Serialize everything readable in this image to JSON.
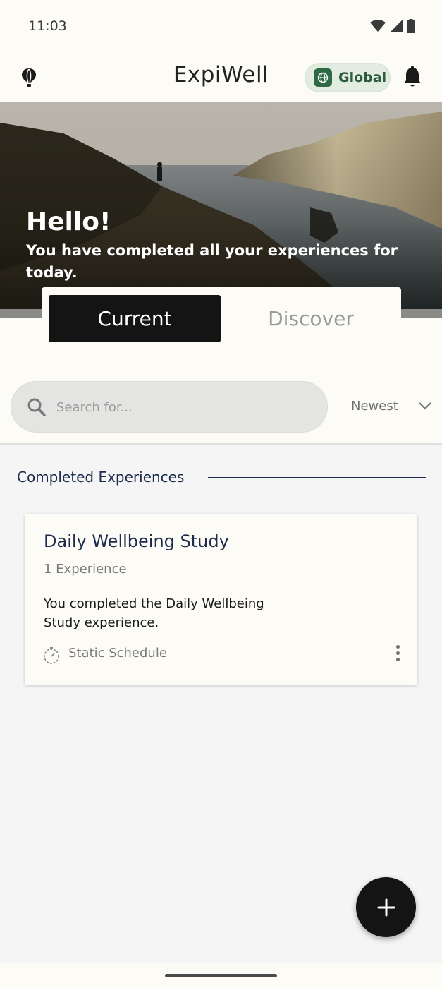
{
  "status_bar": {
    "time": "11:03",
    "icons": [
      "wifi-icon",
      "signal-icon",
      "battery-icon"
    ]
  },
  "header": {
    "title": "ExpiWell",
    "scope_chip": "Global",
    "icons": [
      "balloon-icon",
      "globe-icon",
      "bell-icon"
    ]
  },
  "hero": {
    "greeting": "Hello!",
    "message": "You have completed all your experiences for today."
  },
  "tabs": [
    {
      "label": "Current",
      "selected": true
    },
    {
      "label": "Discover",
      "selected": false
    }
  ],
  "search": {
    "placeholder": "Search for...",
    "value": ""
  },
  "sort": {
    "selected": "Newest"
  },
  "section": {
    "title": "Completed Experiences"
  },
  "cards": [
    {
      "title": "Daily Wellbeing Study",
      "count": "1 Experience",
      "description": "You completed the Daily Wellbeing Study experience.",
      "schedule": "Static Schedule"
    }
  ],
  "fab": {
    "icon": "plus-icon"
  },
  "colors": {
    "background": "#fcfbf6",
    "page": "#f5f5f6",
    "primary_dark": "#141414",
    "navy": "#1d2c4c",
    "chip_green": "#2e6b45",
    "chip_bg": "#e3ece1"
  }
}
